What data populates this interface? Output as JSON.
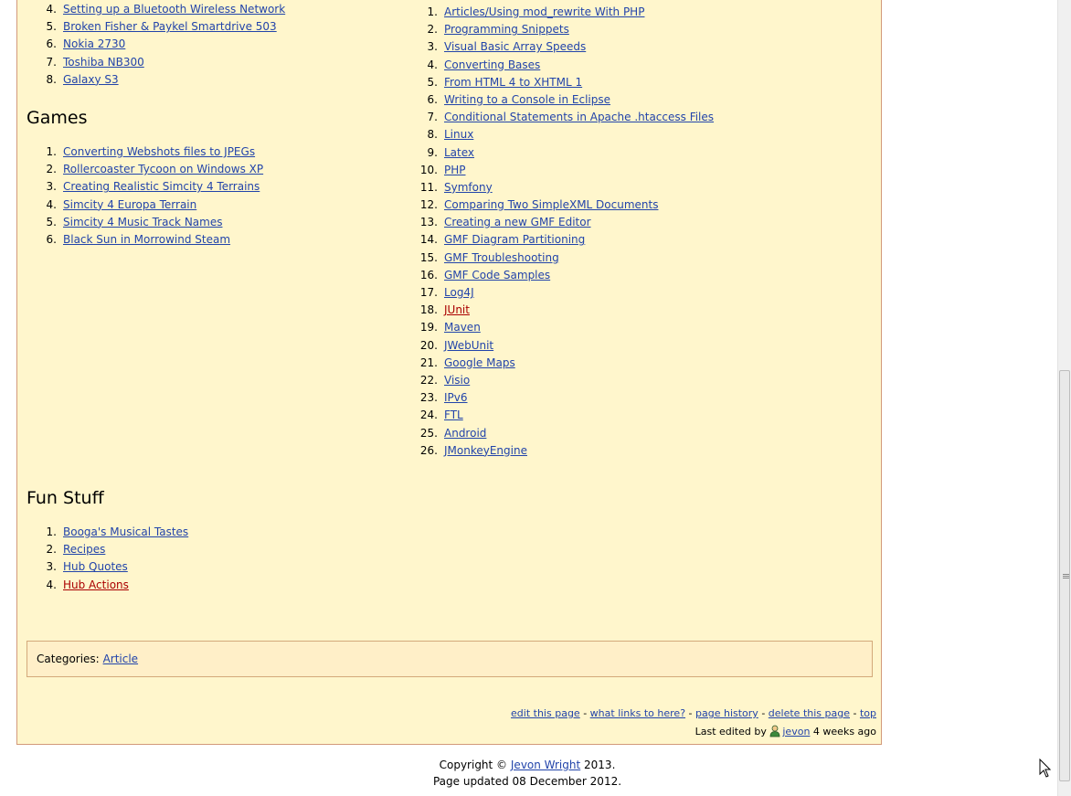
{
  "hardware": {
    "items": [
      {
        "num": "4.",
        "label": "Setting up a Bluetooth Wireless Network"
      },
      {
        "num": "5.",
        "label": "Broken Fisher & Paykel Smartdrive 503"
      },
      {
        "num": "6.",
        "label": "Nokia 2730"
      },
      {
        "num": "7.",
        "label": "Toshiba NB300"
      },
      {
        "num": "8.",
        "label": "Galaxy S3"
      }
    ]
  },
  "games": {
    "title": "Games",
    "items": [
      {
        "num": "1.",
        "label": "Converting Webshots files to JPEGs"
      },
      {
        "num": "2.",
        "label": "Rollercoaster Tycoon on Windows XP"
      },
      {
        "num": "3.",
        "label": "Creating Realistic Simcity 4 Terrains"
      },
      {
        "num": "4.",
        "label": "Simcity 4 Europa Terrain"
      },
      {
        "num": "5.",
        "label": "Simcity 4 Music Track Names"
      },
      {
        "num": "6.",
        "label": "Black Sun in Morrowind Steam"
      }
    ]
  },
  "programming": {
    "items": [
      {
        "num": "1.",
        "label": "Articles/Using mod_rewrite With PHP"
      },
      {
        "num": "2.",
        "label": "Programming Snippets"
      },
      {
        "num": "3.",
        "label": "Visual Basic Array Speeds"
      },
      {
        "num": "4.",
        "label": "Converting Bases"
      },
      {
        "num": "5.",
        "label": "From HTML 4 to XHTML 1"
      },
      {
        "num": "6.",
        "label": "Writing to a Console in Eclipse"
      },
      {
        "num": "7.",
        "label": "Conditional Statements in Apache .htaccess Files"
      },
      {
        "num": "8.",
        "label": "Linux"
      },
      {
        "num": "9.",
        "label": "Latex"
      },
      {
        "num": "10.",
        "label": "PHP"
      },
      {
        "num": "11.",
        "label": "Symfony"
      },
      {
        "num": "12.",
        "label": "Comparing Two SimpleXML Documents"
      },
      {
        "num": "13.",
        "label": "Creating a new GMF Editor"
      },
      {
        "num": "14.",
        "label": "GMF Diagram Partitioning"
      },
      {
        "num": "15.",
        "label": "GMF Troubleshooting"
      },
      {
        "num": "16.",
        "label": "GMF Code Samples"
      },
      {
        "num": "17.",
        "label": "Log4J"
      },
      {
        "num": "18.",
        "label": "JUnit",
        "missing": true
      },
      {
        "num": "19.",
        "label": "Maven"
      },
      {
        "num": "20.",
        "label": "JWebUnit"
      },
      {
        "num": "21.",
        "label": "Google Maps"
      },
      {
        "num": "22.",
        "label": "Visio"
      },
      {
        "num": "23.",
        "label": "IPv6"
      },
      {
        "num": "24.",
        "label": "FTL"
      },
      {
        "num": "25.",
        "label": "Android"
      },
      {
        "num": "26.",
        "label": "JMonkeyEngine"
      }
    ]
  },
  "fun": {
    "title": "Fun Stuff",
    "items": [
      {
        "num": "1.",
        "label": "Booga's Musical Tastes"
      },
      {
        "num": "2.",
        "label": "Recipes"
      },
      {
        "num": "3.",
        "label": "Hub Quotes"
      },
      {
        "num": "4.",
        "label": "Hub Actions",
        "missing": true
      }
    ]
  },
  "categories": {
    "label": "Categories:",
    "link": "Article"
  },
  "footer": {
    "edit": "edit this page",
    "what_links": "what links to here?",
    "history": "page history",
    "delete": "delete this page",
    "top": "top",
    "sep": " - ",
    "last_edited_prefix": "Last edited by",
    "user": "jevon",
    "when": "4 weeks ago"
  },
  "copyright": {
    "prefix": "Copyright ©",
    "author": "Jevon Wright",
    "year": "2013.",
    "updated": "Page updated 08 December 2012."
  },
  "colors": {
    "link": "#2244aa",
    "missing_link": "#aa0000",
    "panel": "#fff6cc"
  }
}
